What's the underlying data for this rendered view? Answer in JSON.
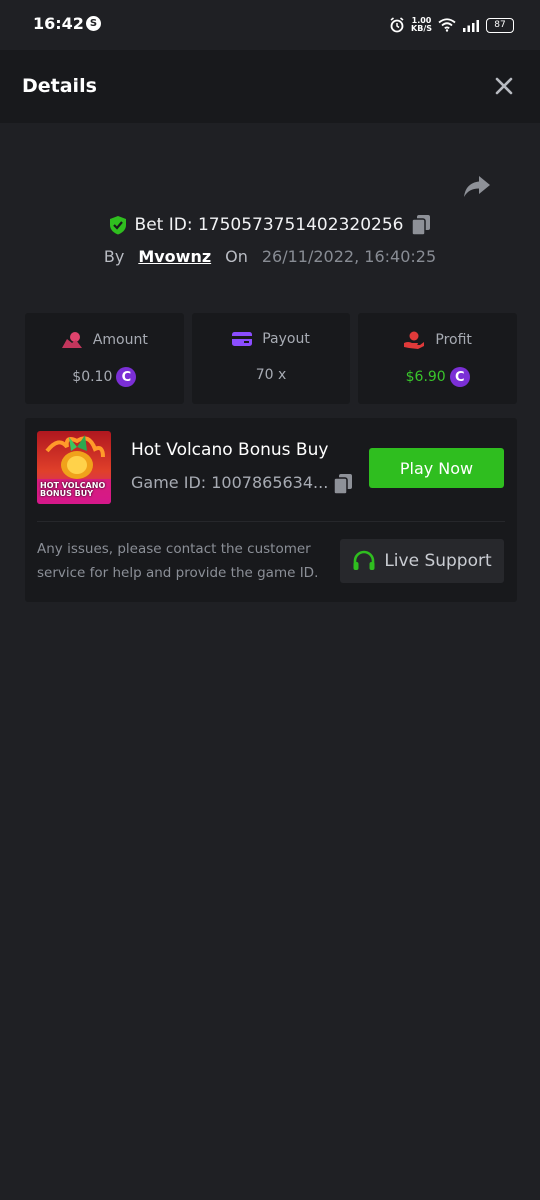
{
  "status_bar": {
    "time": "16:42",
    "speed_value": "1.00",
    "speed_unit": "KB/S",
    "battery": "87"
  },
  "header": {
    "title": "Details",
    "close_icon": "close-icon"
  },
  "bet": {
    "id_text": "Bet ID: 1750573751402320256",
    "by_label": "By",
    "user": "Mvownz",
    "on_label": "On",
    "date": "26/11/2022, 16:40:25"
  },
  "stats": [
    {
      "label": "Amount",
      "value": "$0.10",
      "icon": "amount-icon",
      "color": "#e0436d"
    },
    {
      "label": "Payout",
      "value": "70 x",
      "icon": "card-icon",
      "color": "#8b4dff"
    },
    {
      "label": "Profit",
      "value": "$6.90",
      "icon": "profit-icon",
      "color": "#e03a3a"
    }
  ],
  "coin_symbol": "C",
  "game": {
    "name": "Hot Volcano Bonus Buy",
    "id_text": "Game ID: 1007865634...",
    "thumb_line1": "HOT VOLCANO",
    "thumb_line2": "BONUS BUY",
    "play_label": "Play Now",
    "support_text": "Any issues, please contact the customer service for help and provide the game ID.",
    "support_label": "Live Support"
  },
  "colors": {
    "accent_green": "#2fbe1f",
    "coin_purple": "#7b2fd6",
    "background": "#1f2024",
    "card": "#18191c"
  }
}
